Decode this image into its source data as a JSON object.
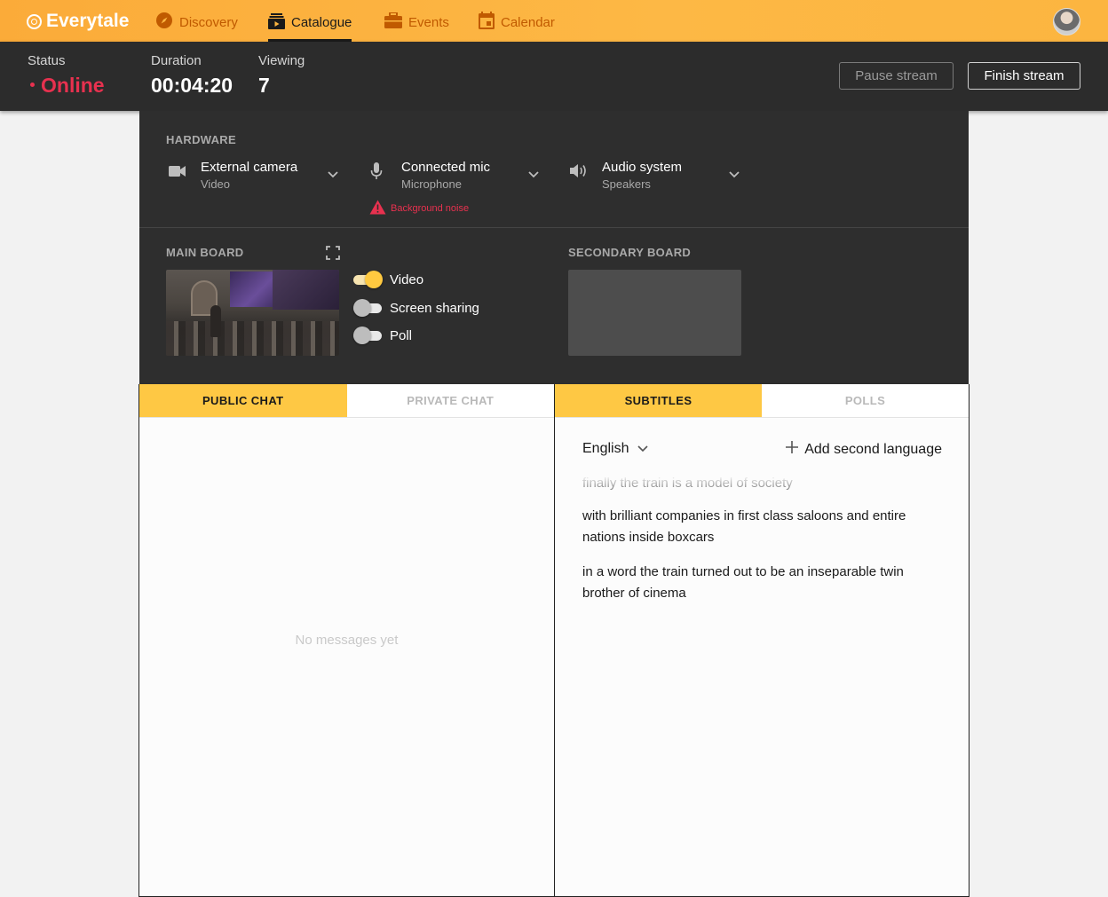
{
  "app": {
    "brand": "Everytale",
    "accent": "#fcb540",
    "alert_color": "#e8314f"
  },
  "nav": {
    "items": [
      {
        "label": "Discovery",
        "icon": "compass-icon",
        "active": false
      },
      {
        "label": "Catalogue",
        "icon": "catalogue-icon",
        "active": true
      },
      {
        "label": "Events",
        "icon": "briefcase-icon",
        "active": false
      },
      {
        "label": "Calendar",
        "icon": "calendar-icon",
        "active": false
      }
    ],
    "avatar": "user-avatar"
  },
  "status_bar": {
    "status_label": "Status",
    "status_value": "Online",
    "duration_label": "Duration",
    "duration_value": "00:04:20",
    "viewing_label": "Viewing",
    "viewing_value": "7",
    "pause_label": "Pause stream",
    "finish_label": "Finish stream"
  },
  "hardware": {
    "title": "HARDWARE",
    "devices": [
      {
        "name": "External camera",
        "type": "Video",
        "icon": "video-camera-icon"
      },
      {
        "name": "Connected mic",
        "type": "Microphone",
        "icon": "microphone-icon",
        "warning": "Background noise"
      },
      {
        "name": "Audio system",
        "type": "Speakers",
        "icon": "speaker-icon"
      }
    ]
  },
  "boards": {
    "main_title": "MAIN BOARD",
    "secondary_title": "SECONDARY BOARD",
    "toggles": [
      {
        "label": "Video",
        "on": true
      },
      {
        "label": "Screen sharing",
        "on": false
      },
      {
        "label": "Poll",
        "on": false
      }
    ]
  },
  "chat": {
    "tabs": [
      {
        "label": "PUBLIC CHAT",
        "active": true
      },
      {
        "label": "PRIVATE CHAT",
        "active": false
      }
    ],
    "empty_text": "No messages yet"
  },
  "subtitles": {
    "tabs": [
      {
        "label": "SUBTITLES",
        "active": true
      },
      {
        "label": "POLLS",
        "active": false
      }
    ],
    "language": "English",
    "add_language": "Add second language",
    "lines": [
      "finally the train is a model of society",
      "with brilliant companies in first class saloons and entire nations inside boxcars",
      "in a word the train turned out to be an inseparable twin brother of cinema"
    ]
  }
}
